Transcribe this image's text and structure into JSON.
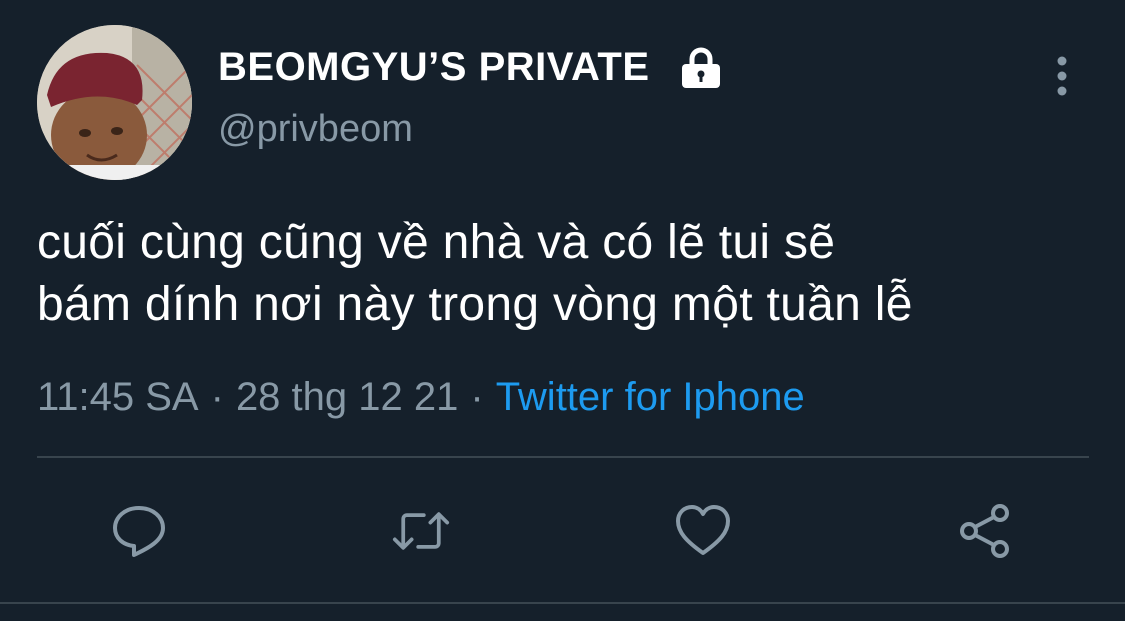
{
  "user": {
    "display_name": "BEOMGYU’S PRIVATE",
    "username": "@privbeom",
    "protected_icon": "lock-icon"
  },
  "tweet": {
    "text_line1": "cuối cùng cũng về nhà và có lẽ tui sẽ",
    "text_line2": "bám dính nơi này trong vòng một tuần lễ",
    "time": "11:45 SA",
    "date": "28 thg 12 21",
    "source": "Twitter for Iphone",
    "separator": "·"
  },
  "actions": {
    "reply_icon": "reply-icon",
    "retweet_icon": "retweet-icon",
    "like_icon": "heart-icon",
    "share_icon": "share-icon"
  },
  "colors": {
    "background": "#15202b",
    "text": "#ffffff",
    "muted": "#8899a6",
    "link": "#1d9bf0",
    "divider": "#38444d"
  }
}
